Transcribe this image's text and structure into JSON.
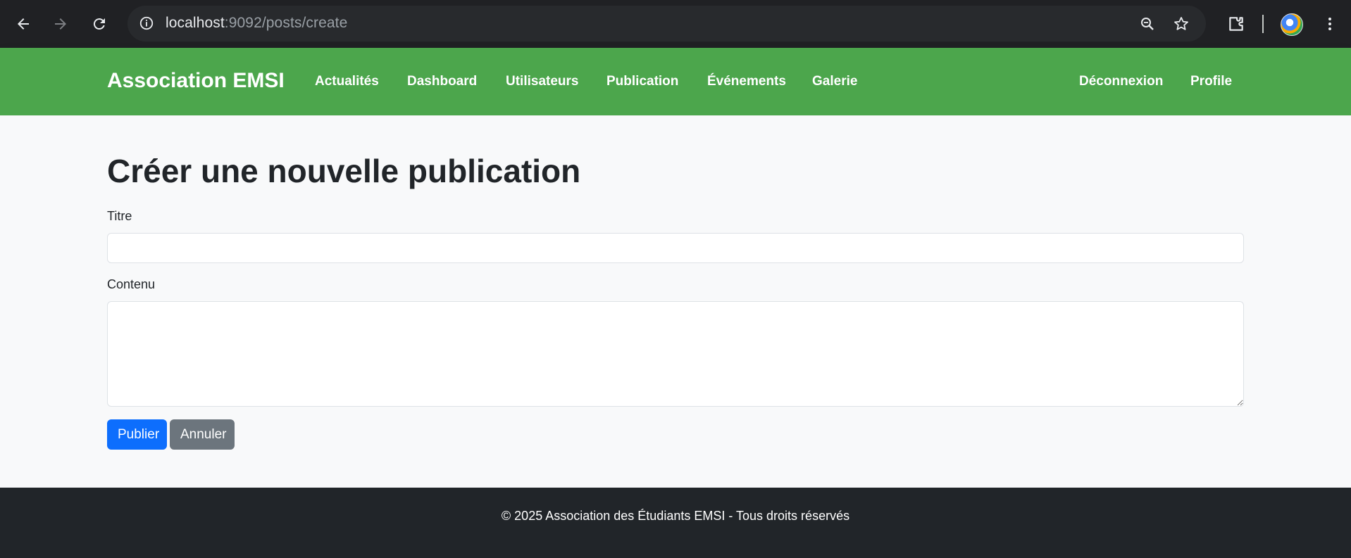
{
  "browser": {
    "url_host": "localhost",
    "url_path": ":9092/posts/create",
    "icons": [
      "back-icon",
      "forward-icon",
      "reload-icon",
      "site-info-icon",
      "zoom-icon",
      "bookmark-star-icon",
      "extensions-icon",
      "profile-avatar",
      "menu-kebab-icon"
    ]
  },
  "navbar": {
    "brand": "Association EMSI",
    "color": "#4ca64c",
    "links": [
      "Actualités",
      "Dashboard",
      "Utilisateurs",
      "Publication",
      "Événements",
      "Galerie"
    ],
    "right_links": [
      "Déconnexion",
      "Profile"
    ]
  },
  "form": {
    "title": "Créer une nouvelle publication",
    "titre_label": "Titre",
    "titre_value": "",
    "contenu_label": "Contenu",
    "contenu_value": "",
    "submit_label": "Publier",
    "cancel_label": "Annuler",
    "submit_color": "#0d6efd",
    "cancel_color": "#6c757d"
  },
  "footer": {
    "text": "© 2025 Association des Étudiants EMSI - Tous droits réservés"
  }
}
